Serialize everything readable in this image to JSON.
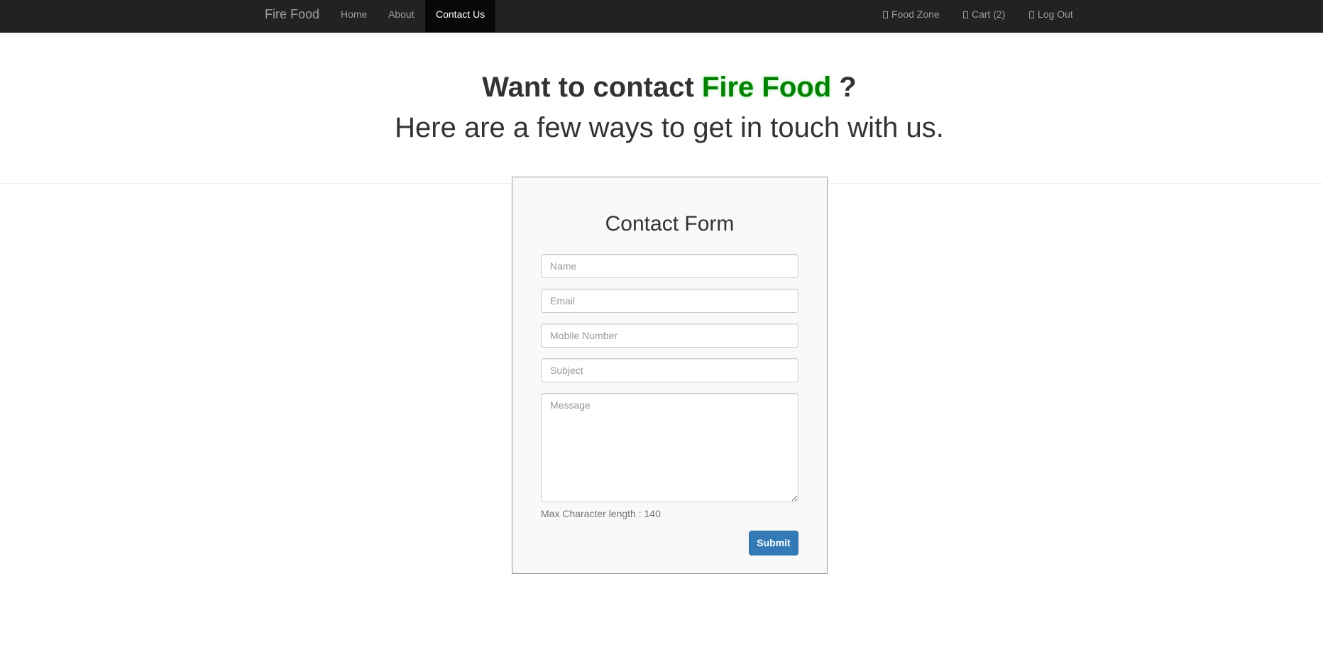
{
  "navbar": {
    "brand": "Fire Food",
    "left_links": [
      {
        "label": "Home"
      },
      {
        "label": "About"
      },
      {
        "label": "Contact Us",
        "active": true
      }
    ],
    "right_links": [
      {
        "label": "Food Zone",
        "icon": "food-zone-icon"
      },
      {
        "label": "Cart (2)",
        "icon": "cart-icon"
      },
      {
        "label": "Log Out",
        "icon": "logout-icon"
      }
    ],
    "colors": {
      "background": "#222222",
      "active_bg": "#080808",
      "link": "#9d9d9d",
      "active_link": "#ffffff"
    }
  },
  "hero": {
    "title_prefix": "Want to contact",
    "title_brand": "Fire Food",
    "title_suffix": "?",
    "subtitle": "Here are a few ways to get in touch with us.",
    "brand_color": "#008000"
  },
  "form": {
    "title": "Contact Form",
    "name_placeholder": "Name",
    "email_placeholder": "Email",
    "mobile_placeholder": "Mobile Number",
    "subject_placeholder": "Subject",
    "message_placeholder": "Message",
    "hint": "Max Character length : 140",
    "submit_label": "Submit",
    "submit_color": "#337ab7"
  }
}
